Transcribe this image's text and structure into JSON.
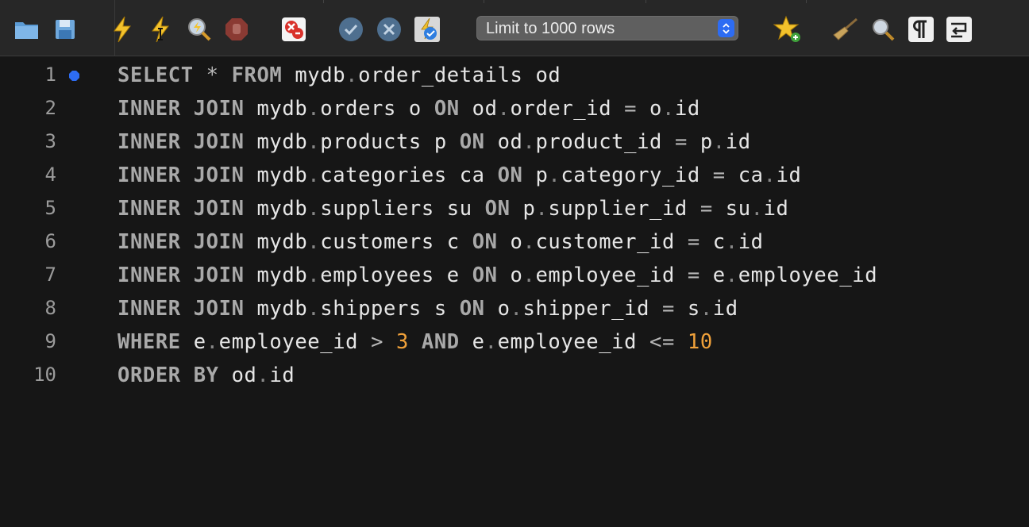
{
  "toolbar": {
    "buttons": [
      {
        "name": "open-folder",
        "icon": "folder-icon"
      },
      {
        "name": "save",
        "icon": "save-icon"
      },
      {
        "name": "execute",
        "icon": "lightning-icon"
      },
      {
        "name": "execute-current",
        "icon": "lightning-cursor-icon"
      },
      {
        "name": "explain",
        "icon": "magnifier-lightning-icon"
      },
      {
        "name": "stop",
        "icon": "stop-hand-icon"
      },
      {
        "name": "toggle-stop-on-error",
        "icon": "error-stop-icon"
      },
      {
        "name": "commit",
        "icon": "check-icon"
      },
      {
        "name": "rollback",
        "icon": "x-circle-icon"
      },
      {
        "name": "autocommit",
        "icon": "autocommit-icon"
      },
      {
        "name": "add-snippet",
        "icon": "star-plus-icon"
      },
      {
        "name": "beautify",
        "icon": "broom-icon"
      },
      {
        "name": "find",
        "icon": "search-icon"
      },
      {
        "name": "toggle-invisibles",
        "icon": "pilcrow-icon"
      },
      {
        "name": "toggle-wrap",
        "icon": "wrap-icon"
      }
    ],
    "limit_select": {
      "value": "Limit to 1000 rows"
    },
    "accent": "#2d6cf3"
  },
  "editor": {
    "lines": [
      {
        "n": "1",
        "tokens": [
          [
            "kw",
            "SELECT"
          ],
          [
            "t",
            " "
          ],
          [
            "op",
            "*"
          ],
          [
            "t",
            " "
          ],
          [
            "kw",
            "FROM"
          ],
          [
            "t",
            " mydb"
          ],
          [
            "dot",
            "."
          ],
          [
            "t",
            "order_details od"
          ]
        ]
      },
      {
        "n": "2",
        "tokens": [
          [
            "kw",
            "INNER JOIN"
          ],
          [
            "t",
            " mydb"
          ],
          [
            "dot",
            "."
          ],
          [
            "t",
            "orders o "
          ],
          [
            "kw",
            "ON"
          ],
          [
            "t",
            " od"
          ],
          [
            "dot",
            "."
          ],
          [
            "t",
            "order_id "
          ],
          [
            "op",
            "="
          ],
          [
            "t",
            " o"
          ],
          [
            "dot",
            "."
          ],
          [
            "t",
            "id"
          ]
        ]
      },
      {
        "n": "3",
        "tokens": [
          [
            "kw",
            "INNER JOIN"
          ],
          [
            "t",
            " mydb"
          ],
          [
            "dot",
            "."
          ],
          [
            "t",
            "products p "
          ],
          [
            "kw",
            "ON"
          ],
          [
            "t",
            " od"
          ],
          [
            "dot",
            "."
          ],
          [
            "t",
            "product_id "
          ],
          [
            "op",
            "="
          ],
          [
            "t",
            " p"
          ],
          [
            "dot",
            "."
          ],
          [
            "t",
            "id"
          ]
        ]
      },
      {
        "n": "4",
        "tokens": [
          [
            "kw",
            "INNER JOIN"
          ],
          [
            "t",
            " mydb"
          ],
          [
            "dot",
            "."
          ],
          [
            "t",
            "categories ca "
          ],
          [
            "kw",
            "ON"
          ],
          [
            "t",
            " p"
          ],
          [
            "dot",
            "."
          ],
          [
            "t",
            "category_id "
          ],
          [
            "op",
            "="
          ],
          [
            "t",
            " ca"
          ],
          [
            "dot",
            "."
          ],
          [
            "t",
            "id"
          ]
        ]
      },
      {
        "n": "5",
        "tokens": [
          [
            "kw",
            "INNER JOIN"
          ],
          [
            "t",
            " mydb"
          ],
          [
            "dot",
            "."
          ],
          [
            "t",
            "suppliers su "
          ],
          [
            "kw",
            "ON"
          ],
          [
            "t",
            " p"
          ],
          [
            "dot",
            "."
          ],
          [
            "t",
            "supplier_id "
          ],
          [
            "op",
            "="
          ],
          [
            "t",
            " su"
          ],
          [
            "dot",
            "."
          ],
          [
            "t",
            "id"
          ]
        ]
      },
      {
        "n": "6",
        "tokens": [
          [
            "kw",
            "INNER JOIN"
          ],
          [
            "t",
            " mydb"
          ],
          [
            "dot",
            "."
          ],
          [
            "t",
            "customers c "
          ],
          [
            "kw",
            "ON"
          ],
          [
            "t",
            " o"
          ],
          [
            "dot",
            "."
          ],
          [
            "t",
            "customer_id "
          ],
          [
            "op",
            "="
          ],
          [
            "t",
            " c"
          ],
          [
            "dot",
            "."
          ],
          [
            "t",
            "id"
          ]
        ]
      },
      {
        "n": "7",
        "tokens": [
          [
            "kw",
            "INNER JOIN"
          ],
          [
            "t",
            " mydb"
          ],
          [
            "dot",
            "."
          ],
          [
            "t",
            "employees e "
          ],
          [
            "kw",
            "ON"
          ],
          [
            "t",
            " o"
          ],
          [
            "dot",
            "."
          ],
          [
            "t",
            "employee_id "
          ],
          [
            "op",
            "="
          ],
          [
            "t",
            " e"
          ],
          [
            "dot",
            "."
          ],
          [
            "t",
            "employee_id"
          ]
        ]
      },
      {
        "n": "8",
        "tokens": [
          [
            "kw",
            "INNER JOIN"
          ],
          [
            "t",
            " mydb"
          ],
          [
            "dot",
            "."
          ],
          [
            "t",
            "shippers s "
          ],
          [
            "kw",
            "ON"
          ],
          [
            "t",
            " o"
          ],
          [
            "dot",
            "."
          ],
          [
            "t",
            "shipper_id "
          ],
          [
            "op",
            "="
          ],
          [
            "t",
            " s"
          ],
          [
            "dot",
            "."
          ],
          [
            "t",
            "id"
          ]
        ]
      },
      {
        "n": "9",
        "tokens": [
          [
            "kw",
            "WHERE"
          ],
          [
            "t",
            " e"
          ],
          [
            "dot",
            "."
          ],
          [
            "t",
            "employee_id "
          ],
          [
            "op",
            ">"
          ],
          [
            "t",
            " "
          ],
          [
            "num",
            "3"
          ],
          [
            "t",
            " "
          ],
          [
            "kw",
            "AND"
          ],
          [
            "t",
            " e"
          ],
          [
            "dot",
            "."
          ],
          [
            "t",
            "employee_id "
          ],
          [
            "op",
            "<="
          ],
          [
            "t",
            " "
          ],
          [
            "num",
            "10"
          ]
        ]
      },
      {
        "n": "10",
        "tokens": [
          [
            "kw",
            "ORDER BY"
          ],
          [
            "t",
            " od"
          ],
          [
            "dot",
            "."
          ],
          [
            "t",
            "id"
          ]
        ]
      }
    ],
    "colors": {
      "keyword": "#a9a9a9",
      "number": "#f0a13a",
      "text": "#e6e6e6",
      "marker": "#2d6cf3"
    }
  }
}
